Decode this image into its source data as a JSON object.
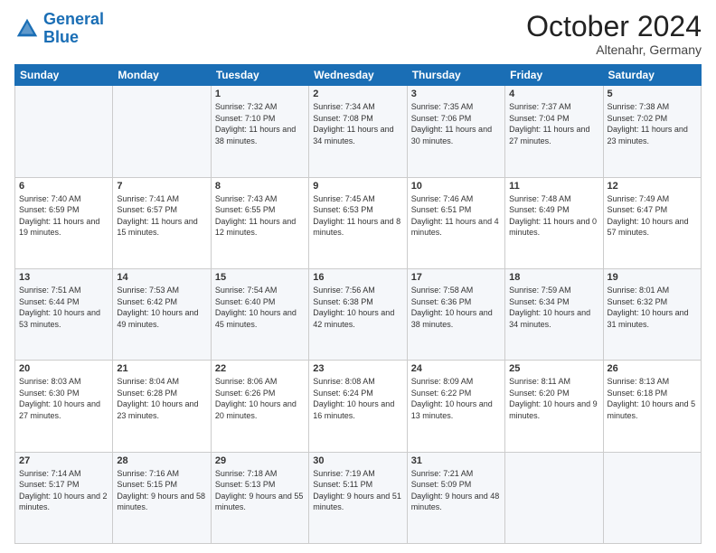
{
  "header": {
    "logo_line1": "General",
    "logo_line2": "Blue",
    "month": "October 2024",
    "location": "Altenahr, Germany"
  },
  "weekdays": [
    "Sunday",
    "Monday",
    "Tuesday",
    "Wednesday",
    "Thursday",
    "Friday",
    "Saturday"
  ],
  "weeks": [
    [
      {
        "day": "",
        "info": ""
      },
      {
        "day": "",
        "info": ""
      },
      {
        "day": "1",
        "info": "Sunrise: 7:32 AM\nSunset: 7:10 PM\nDaylight: 11 hours and 38 minutes."
      },
      {
        "day": "2",
        "info": "Sunrise: 7:34 AM\nSunset: 7:08 PM\nDaylight: 11 hours and 34 minutes."
      },
      {
        "day": "3",
        "info": "Sunrise: 7:35 AM\nSunset: 7:06 PM\nDaylight: 11 hours and 30 minutes."
      },
      {
        "day": "4",
        "info": "Sunrise: 7:37 AM\nSunset: 7:04 PM\nDaylight: 11 hours and 27 minutes."
      },
      {
        "day": "5",
        "info": "Sunrise: 7:38 AM\nSunset: 7:02 PM\nDaylight: 11 hours and 23 minutes."
      }
    ],
    [
      {
        "day": "6",
        "info": "Sunrise: 7:40 AM\nSunset: 6:59 PM\nDaylight: 11 hours and 19 minutes."
      },
      {
        "day": "7",
        "info": "Sunrise: 7:41 AM\nSunset: 6:57 PM\nDaylight: 11 hours and 15 minutes."
      },
      {
        "day": "8",
        "info": "Sunrise: 7:43 AM\nSunset: 6:55 PM\nDaylight: 11 hours and 12 minutes."
      },
      {
        "day": "9",
        "info": "Sunrise: 7:45 AM\nSunset: 6:53 PM\nDaylight: 11 hours and 8 minutes."
      },
      {
        "day": "10",
        "info": "Sunrise: 7:46 AM\nSunset: 6:51 PM\nDaylight: 11 hours and 4 minutes."
      },
      {
        "day": "11",
        "info": "Sunrise: 7:48 AM\nSunset: 6:49 PM\nDaylight: 11 hours and 0 minutes."
      },
      {
        "day": "12",
        "info": "Sunrise: 7:49 AM\nSunset: 6:47 PM\nDaylight: 10 hours and 57 minutes."
      }
    ],
    [
      {
        "day": "13",
        "info": "Sunrise: 7:51 AM\nSunset: 6:44 PM\nDaylight: 10 hours and 53 minutes."
      },
      {
        "day": "14",
        "info": "Sunrise: 7:53 AM\nSunset: 6:42 PM\nDaylight: 10 hours and 49 minutes."
      },
      {
        "day": "15",
        "info": "Sunrise: 7:54 AM\nSunset: 6:40 PM\nDaylight: 10 hours and 45 minutes."
      },
      {
        "day": "16",
        "info": "Sunrise: 7:56 AM\nSunset: 6:38 PM\nDaylight: 10 hours and 42 minutes."
      },
      {
        "day": "17",
        "info": "Sunrise: 7:58 AM\nSunset: 6:36 PM\nDaylight: 10 hours and 38 minutes."
      },
      {
        "day": "18",
        "info": "Sunrise: 7:59 AM\nSunset: 6:34 PM\nDaylight: 10 hours and 34 minutes."
      },
      {
        "day": "19",
        "info": "Sunrise: 8:01 AM\nSunset: 6:32 PM\nDaylight: 10 hours and 31 minutes."
      }
    ],
    [
      {
        "day": "20",
        "info": "Sunrise: 8:03 AM\nSunset: 6:30 PM\nDaylight: 10 hours and 27 minutes."
      },
      {
        "day": "21",
        "info": "Sunrise: 8:04 AM\nSunset: 6:28 PM\nDaylight: 10 hours and 23 minutes."
      },
      {
        "day": "22",
        "info": "Sunrise: 8:06 AM\nSunset: 6:26 PM\nDaylight: 10 hours and 20 minutes."
      },
      {
        "day": "23",
        "info": "Sunrise: 8:08 AM\nSunset: 6:24 PM\nDaylight: 10 hours and 16 minutes."
      },
      {
        "day": "24",
        "info": "Sunrise: 8:09 AM\nSunset: 6:22 PM\nDaylight: 10 hours and 13 minutes."
      },
      {
        "day": "25",
        "info": "Sunrise: 8:11 AM\nSunset: 6:20 PM\nDaylight: 10 hours and 9 minutes."
      },
      {
        "day": "26",
        "info": "Sunrise: 8:13 AM\nSunset: 6:18 PM\nDaylight: 10 hours and 5 minutes."
      }
    ],
    [
      {
        "day": "27",
        "info": "Sunrise: 7:14 AM\nSunset: 5:17 PM\nDaylight: 10 hours and 2 minutes."
      },
      {
        "day": "28",
        "info": "Sunrise: 7:16 AM\nSunset: 5:15 PM\nDaylight: 9 hours and 58 minutes."
      },
      {
        "day": "29",
        "info": "Sunrise: 7:18 AM\nSunset: 5:13 PM\nDaylight: 9 hours and 55 minutes."
      },
      {
        "day": "30",
        "info": "Sunrise: 7:19 AM\nSunset: 5:11 PM\nDaylight: 9 hours and 51 minutes."
      },
      {
        "day": "31",
        "info": "Sunrise: 7:21 AM\nSunset: 5:09 PM\nDaylight: 9 hours and 48 minutes."
      },
      {
        "day": "",
        "info": ""
      },
      {
        "day": "",
        "info": ""
      }
    ]
  ]
}
